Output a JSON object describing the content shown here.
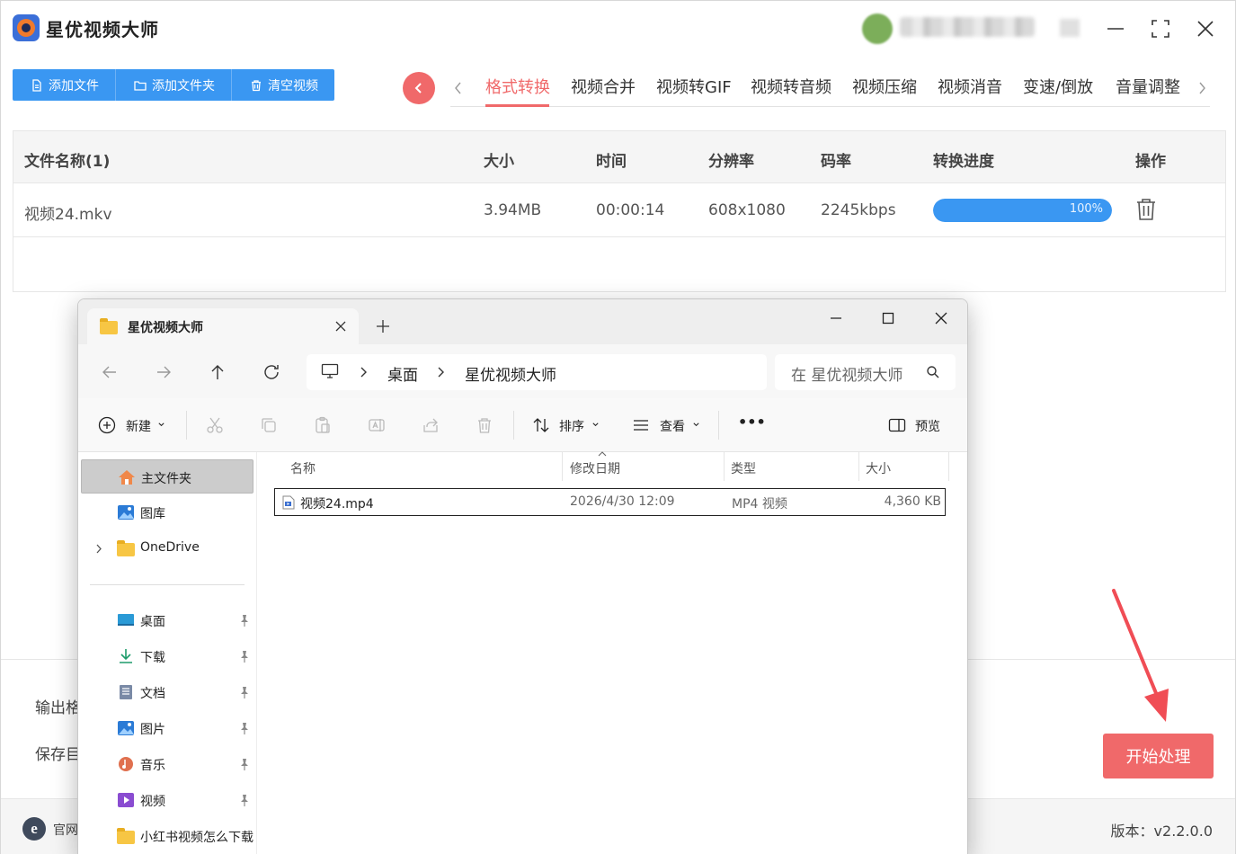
{
  "app": {
    "title": "星优视频大师",
    "toolbar": {
      "add_file": "添加文件",
      "add_folder": "添加文件夹",
      "clear_videos": "清空视频"
    },
    "tabs": [
      "格式转换",
      "视频合并",
      "视频转GIF",
      "视频转音频",
      "视频压缩",
      "视频消音",
      "变速/倒放",
      "音量调整"
    ],
    "active_tab": "格式转换",
    "table": {
      "headers": [
        "文件名称(1)",
        "大小",
        "时间",
        "分辨率",
        "码率",
        "转换进度",
        "操作"
      ],
      "rows": [
        {
          "name": "视频24.mkv",
          "size": "3.94MB",
          "duration": "00:00:14",
          "resolution": "608x1080",
          "bitrate": "2245kbps",
          "progress_text": "100%",
          "progress_percent": 100
        }
      ]
    },
    "output_format_label": "输出格",
    "save_dir_label": "保存目",
    "start_button": "开始处理",
    "site_label": "官网",
    "site_icon_letter": "e",
    "version": "版本：v2.2.0.0",
    "colors": {
      "accent_blue": "#3a97f2",
      "accent_red": "#f0696a"
    }
  },
  "explorer": {
    "tab_title": "星优视频大师",
    "breadcrumb": [
      "桌面",
      "星优视频大师"
    ],
    "search_placeholder": "在 星优视频大师",
    "commands": {
      "new": "新建",
      "sort": "排序",
      "view": "查看",
      "more": "•••",
      "preview": "预览"
    },
    "sidebar": [
      {
        "label": "主文件夹",
        "icon": "home-icon"
      },
      {
        "label": "图库",
        "icon": "gallery-icon"
      },
      {
        "label": "OneDrive",
        "icon": "folder-icon"
      },
      {
        "label": "桌面",
        "icon": "desktop-icon"
      },
      {
        "label": "下载",
        "icon": "download-icon"
      },
      {
        "label": "文档",
        "icon": "document-icon"
      },
      {
        "label": "图片",
        "icon": "pictures-icon"
      },
      {
        "label": "音乐",
        "icon": "music-icon"
      },
      {
        "label": "视频",
        "icon": "video-icon"
      },
      {
        "label": "小红书视频怎么下载",
        "icon": "folder-icon"
      }
    ],
    "columns": [
      "名称",
      "修改日期",
      "类型",
      "大小"
    ],
    "files": [
      {
        "name": "视频24.mp4",
        "modified": "2026/4/30 12:09",
        "type": "MP4 视频",
        "size": "4,360 KB"
      }
    ]
  }
}
